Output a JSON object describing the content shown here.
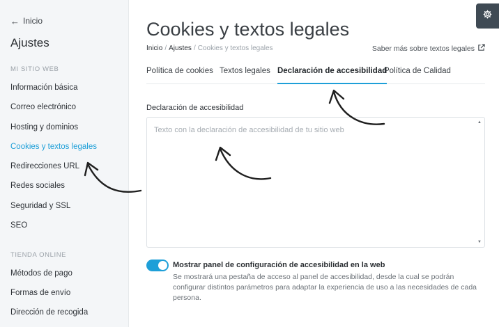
{
  "sidebar": {
    "back_label": "Inicio",
    "title": "Ajustes",
    "sections": [
      {
        "label": "MI SITIO WEB",
        "items": [
          {
            "label": "Información básica"
          },
          {
            "label": "Correo electrónico"
          },
          {
            "label": "Hosting y dominios"
          },
          {
            "label": "Cookies y textos legales",
            "active": true
          },
          {
            "label": "Redirecciones URL"
          },
          {
            "label": "Redes sociales"
          },
          {
            "label": "Seguridad y SSL"
          },
          {
            "label": "SEO"
          }
        ]
      },
      {
        "label": "TIENDA ONLINE",
        "items": [
          {
            "label": "Métodos de pago"
          },
          {
            "label": "Formas de envío"
          },
          {
            "label": "Dirección de recogida"
          }
        ]
      }
    ]
  },
  "main": {
    "title": "Cookies y textos legales",
    "breadcrumb": {
      "home": "Inicio",
      "sep": "/",
      "parent": "Ajustes",
      "current": "Cookies y textos legales"
    },
    "help_link": "Saber más sobre textos legales",
    "tabs": [
      {
        "label": "Política de cookies"
      },
      {
        "label": "Textos legales"
      },
      {
        "label": "Declaración de accesibilidad",
        "active": true
      },
      {
        "label": "Política de Calidad"
      }
    ],
    "field": {
      "label": "Declaración de accesibilidad",
      "placeholder": "Texto con la declaración de accesibilidad de tu sitio web",
      "value": ""
    },
    "toggle": {
      "on": true,
      "title": "Mostrar panel de configuración de accesibilidad en la web",
      "description": "Se mostrará una pestaña de acceso al panel de accesibilidad, desde la cual se podrán configurar distintos parámetros para adaptar la experiencia de uso a las necesidades de cada persona."
    }
  },
  "icons": {
    "back": "arrow-left-icon",
    "external": "external-link-icon",
    "settings": "gear-icon",
    "scroll_up": "scroll-up-icon",
    "scroll_down": "scroll-down-icon"
  },
  "colors": {
    "accent": "#1e9fd8",
    "sidebar_bg": "#f4f6f8",
    "settings_bg": "#3f4a54"
  }
}
